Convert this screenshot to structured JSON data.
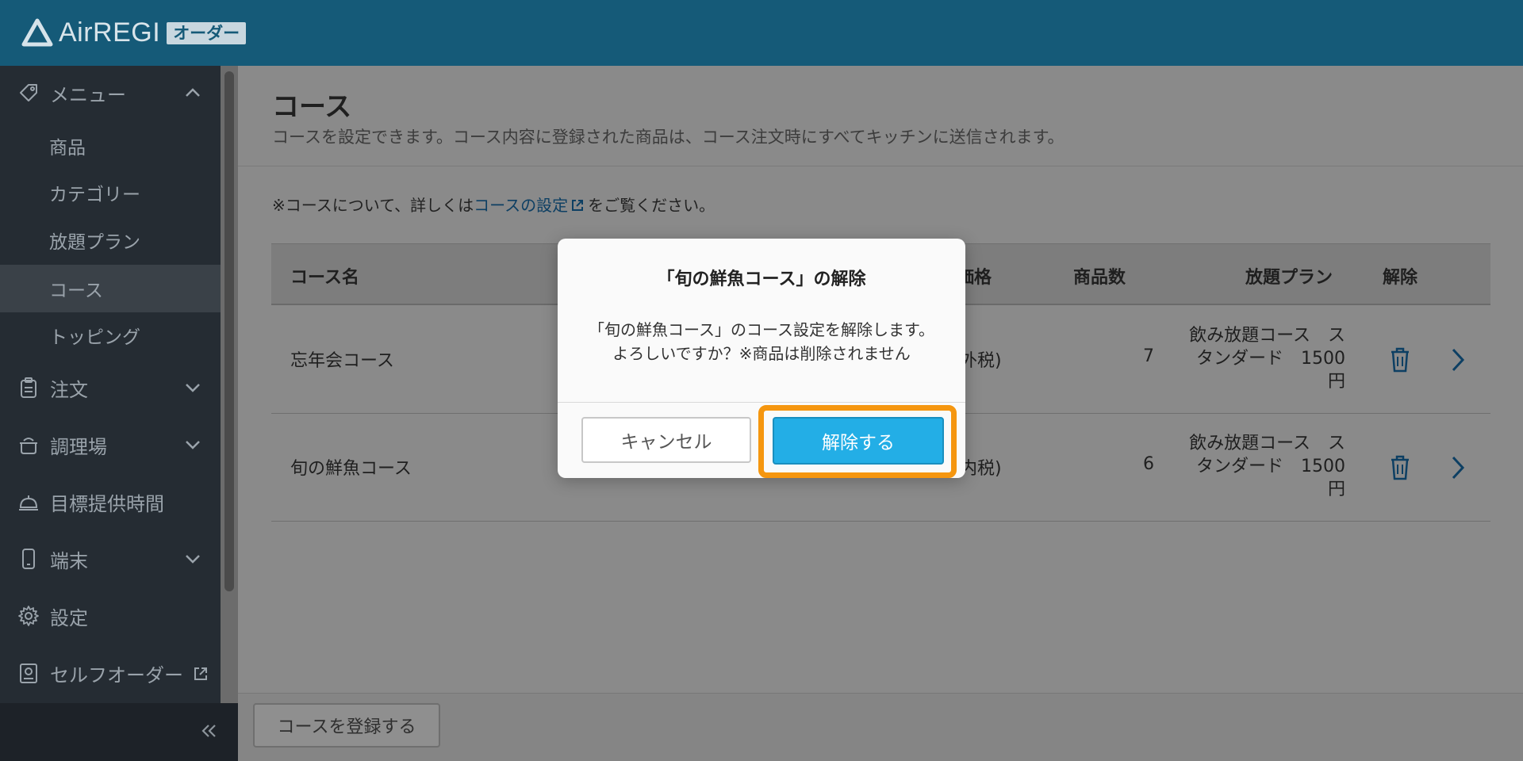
{
  "app": {
    "logo_text": "AirREGI",
    "logo_badge": "オーダー"
  },
  "sidebar": {
    "menu_label": "メニュー",
    "sub_items": [
      {
        "label": "商品"
      },
      {
        "label": "カテゴリー"
      },
      {
        "label": "放題プラン"
      },
      {
        "label": "コース"
      },
      {
        "label": "トッピング"
      }
    ],
    "items": [
      {
        "label": "注文"
      },
      {
        "label": "調理場"
      },
      {
        "label": "目標提供時間"
      },
      {
        "label": "端末"
      },
      {
        "label": "設定"
      },
      {
        "label": "セルフオーダー"
      }
    ]
  },
  "page": {
    "title": "コース",
    "description": "コースを設定できます。コース内容に登録された商品は、コース注文時にすべてキッチンに送信されます。",
    "note_prefix": "※コースについて、詳しくは",
    "note_link": "コースの設定",
    "note_suffix": "をご覧ください。"
  },
  "table": {
    "headers": {
      "name": "コース名",
      "price": "価格",
      "count": "商品数",
      "plan": "放題プラン",
      "remove": "解除"
    },
    "rows": [
      {
        "name": "忘年会コース",
        "price_tail": "外税)",
        "count": "7",
        "plan_line1": "飲み放題コース　ス",
        "plan_line2": "タンダード　1500",
        "plan_line3": "円"
      },
      {
        "name": "旬の鮮魚コース",
        "price_tail": "内税)",
        "count": "6",
        "plan_line1": "飲み放題コース　ス",
        "plan_line2": "タンダード　1500",
        "plan_line3": "円"
      }
    ]
  },
  "footer": {
    "register_label": "コースを登録する"
  },
  "modal": {
    "title": "「旬の鮮魚コース」の解除",
    "body_line1": "「旬の鮮魚コース」のコース設定を解除します。",
    "body_line2": "よろしいですか？※商品は削除されません",
    "cancel_label": "キャンセル",
    "confirm_label": "解除する"
  },
  "colors": {
    "header": "#155a78",
    "accent": "#23aee6",
    "highlight": "#f5960f",
    "icon": "#0d3f63"
  }
}
